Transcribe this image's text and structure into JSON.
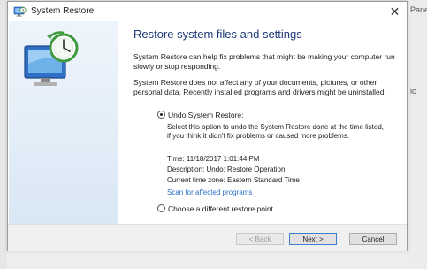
{
  "window": {
    "title": "System Restore",
    "close_glyph": "✕"
  },
  "background": {
    "right_text_top": "Pane",
    "right_text_mid": "ic"
  },
  "content": {
    "heading": "Restore system files and settings",
    "para1": "System Restore can help fix problems that might be making your computer run slowly or stop responding.",
    "para2": "System Restore does not affect any of your documents, pictures, or other personal data. Recently installed programs and drivers might be uninstalled.",
    "options": {
      "undo_label": "Undo System Restore:",
      "undo_description": "Select this option to undo the System Restore done at the time listed, if you think it didn't fix problems or caused more problems.",
      "time": "Time: 11/18/2017 1:01:44 PM",
      "description": "Description: Undo: Restore Operation",
      "timezone": "Current time zone: Eastern Standard Time",
      "scan_link": "Scan for affected programs",
      "choose_label": "Choose a different restore point",
      "selected": "undo"
    }
  },
  "buttons": {
    "back": "< Back",
    "next": "Next >",
    "cancel": "Cancel"
  },
  "icons": {
    "title": "system-restore-icon",
    "hero": "system-restore-clock-icon"
  },
  "colors": {
    "heading": "#1e3a7a",
    "link": "#2a6fc9",
    "sidebar": "#e6f0f9"
  }
}
